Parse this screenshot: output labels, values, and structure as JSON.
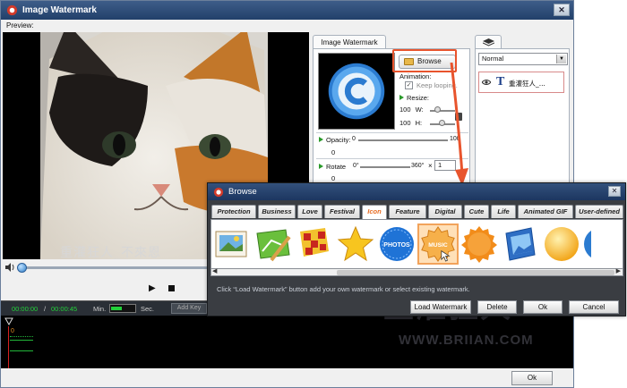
{
  "main_window": {
    "title": "Image Watermark",
    "close_glyph": "✕",
    "preview_label": "Preview:",
    "overlay_text": "重灌狂人_不來恩",
    "time_start": "00:00:00",
    "time_sep": "/",
    "time_end": "00:00:45",
    "min_label": "Min.",
    "sec_label": "Sec.",
    "add_key_label": "Add Key",
    "track_zero": "0",
    "ok_label": "Ok"
  },
  "properties": {
    "tab_label": "Image Watermark",
    "browse_label": "Browse",
    "animation_label": "Animation:",
    "keep_looping_label": "Keep looping.",
    "keep_looping_checked": true,
    "resize_label": "Resize:",
    "width_value": "100",
    "width_label": "W:",
    "height_value": "100",
    "height_label": "H:",
    "opacity_label": "Opacity:",
    "opacity_min": "0",
    "opacity_max": "100",
    "opacity_value": "0",
    "rotate_label": "Rotate",
    "rotate_min": "0°",
    "rotate_max": "360°",
    "rotate_x": "×",
    "rotate_multiplier": "1",
    "rotate_value": "0"
  },
  "layers": {
    "blend_mode": "Normal",
    "items": [
      {
        "type_glyph": "T",
        "name": "重灌狂人_..."
      }
    ]
  },
  "browse_dialog": {
    "title": "Browse",
    "close_glyph": "✕",
    "tabs": [
      "Protection",
      "Business",
      "Love",
      "Festival",
      "Icon",
      "Feature",
      "Digital",
      "Cute",
      "Life",
      "Animated GIF",
      "User-defined"
    ],
    "active_tab": "Icon",
    "icons": [
      {
        "name": "photo-frame-icon"
      },
      {
        "name": "picture-pen-icon"
      },
      {
        "name": "checkered-flag-icon"
      },
      {
        "name": "star-icon"
      },
      {
        "name": "photos-badge-icon",
        "label": "PHOTOS"
      },
      {
        "name": "music-note-icon",
        "label": "MUSIC"
      },
      {
        "name": "orange-seal-icon"
      },
      {
        "name": "photo-blue-icon"
      },
      {
        "name": "yellow-circle-icon"
      }
    ],
    "selected_icon_index": 5,
    "hint": "Click “Load Watermark” button add your own watermark or select existing watermark.",
    "load_label": "Load Watermark",
    "delete_label": "Delete",
    "ok_label": "Ok",
    "cancel_label": "Cancel"
  },
  "site_watermark": {
    "title": "重灌狂人",
    "url": "WWW.BRIIAN.COM"
  },
  "colors": {
    "title_bar": "#2f4f7f",
    "highlight_red": "#e8542d",
    "active_tab_text": "#e66a20",
    "timeline_green": "#22d03a"
  }
}
